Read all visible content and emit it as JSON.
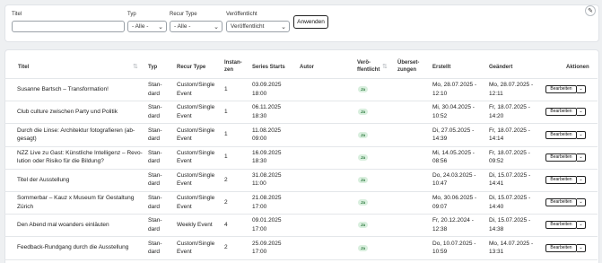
{
  "filters": {
    "title_label": "Titel",
    "title_value": "",
    "type_label": "Typ",
    "type_value": "- Alle -",
    "recur_label": "Recur Type",
    "recur_value": "- Alle -",
    "published_label": "Veröffentlicht",
    "published_value": "Veröffentlicht",
    "apply_label": "Anwenden",
    "edit_icon": "pencil-icon"
  },
  "table": {
    "headers": {
      "title": "Titel",
      "type": "Typ",
      "recur": "Recur Type",
      "instances": "Instan-\nzen",
      "series_starts": "Series Starts",
      "author": "Autor",
      "published": "Verö-\nffentlicht",
      "translations": "Überset-\nzungen",
      "created": "Erstellt",
      "changed": "Geändert",
      "actions": "Aktionen"
    },
    "edit_label": "Bearbeiten",
    "rows": [
      {
        "title": "Susanne Bartsch – Transformation!",
        "type": "Stan-\ndard",
        "recur": "Custom/Single\nEvent",
        "instances": "1",
        "series": "03.09.2025\n18:00",
        "author": "",
        "published": "Ja",
        "created": "Mo, 28.07.2025 -\n12:10",
        "changed": "Mo, 28.07.2025 -\n12:11"
      },
      {
        "title": "Club culture zwischen Party und Politik",
        "type": "Stan-\ndard",
        "recur": "Custom/Single\nEvent",
        "instances": "1",
        "series": "06.11.2025\n18:30",
        "author": "",
        "published": "Ja",
        "created": "Mi, 30.04.2025 -\n10:52",
        "changed": "Fr, 18.07.2025 -\n14:20"
      },
      {
        "title": "Durch die Linse: Architektur fotografieren (ab-\ngesagt)",
        "type": "Stan-\ndard",
        "recur": "Custom/Single\nEvent",
        "instances": "1",
        "series": "11.08.2025\n09:00",
        "author": "",
        "published": "Ja",
        "created": "Di, 27.05.2025 -\n14:39",
        "changed": "Fr, 18.07.2025 -\n14:14"
      },
      {
        "title": "NZZ Live zu Gast: Künstliche Intelligenz – Revo-\nlution oder Risiko für die Bildung?",
        "type": "Stan-\ndard",
        "recur": "Custom/Single\nEvent",
        "instances": "1",
        "series": "16.09.2025\n18:30",
        "author": "",
        "published": "Ja",
        "created": "Mi, 14.05.2025 -\n08:56",
        "changed": "Fr, 18.07.2025 -\n09:52"
      },
      {
        "title": "Titel der Ausstellung",
        "type": "Stan-\ndard",
        "recur": "Custom/Single\nEvent",
        "instances": "2",
        "series": "31.08.2025\n11:00",
        "author": "",
        "published": "Ja",
        "created": "Do, 24.03.2025 -\n10:47",
        "changed": "Di, 15.07.2025 -\n14:41"
      },
      {
        "title": "Sommerbar – Kauz x Museum für Gestaltung\nZürich",
        "type": "Stan-\ndard",
        "recur": "Custom/Single\nEvent",
        "instances": "2",
        "series": "21.08.2025\n17:00",
        "author": "",
        "published": "Ja",
        "created": "Mo, 30.06.2025 -\n09:07",
        "changed": "Di, 15.07.2025 -\n14:40"
      },
      {
        "title": "Den Abend mal woanders einläuten",
        "type": "Stan-\ndard",
        "recur": "Weekly Event",
        "instances": "4",
        "series": "09.01.2025\n17:00",
        "author": "",
        "published": "Ja",
        "created": "Fr, 20.12.2024 -\n12:38",
        "changed": "Di, 15.07.2025 -\n14:38"
      },
      {
        "title": "Feedback-Rundgang durch die Ausstellung",
        "type": "Stan-\ndard",
        "recur": "Custom/Single\nEvent",
        "instances": "2",
        "series": "25.09.2025\n17:00",
        "author": "",
        "published": "Ja",
        "created": "Do, 10.07.2025 -\n10:59",
        "changed": "Mo, 14.07.2025 -\n13:31"
      }
    ]
  }
}
